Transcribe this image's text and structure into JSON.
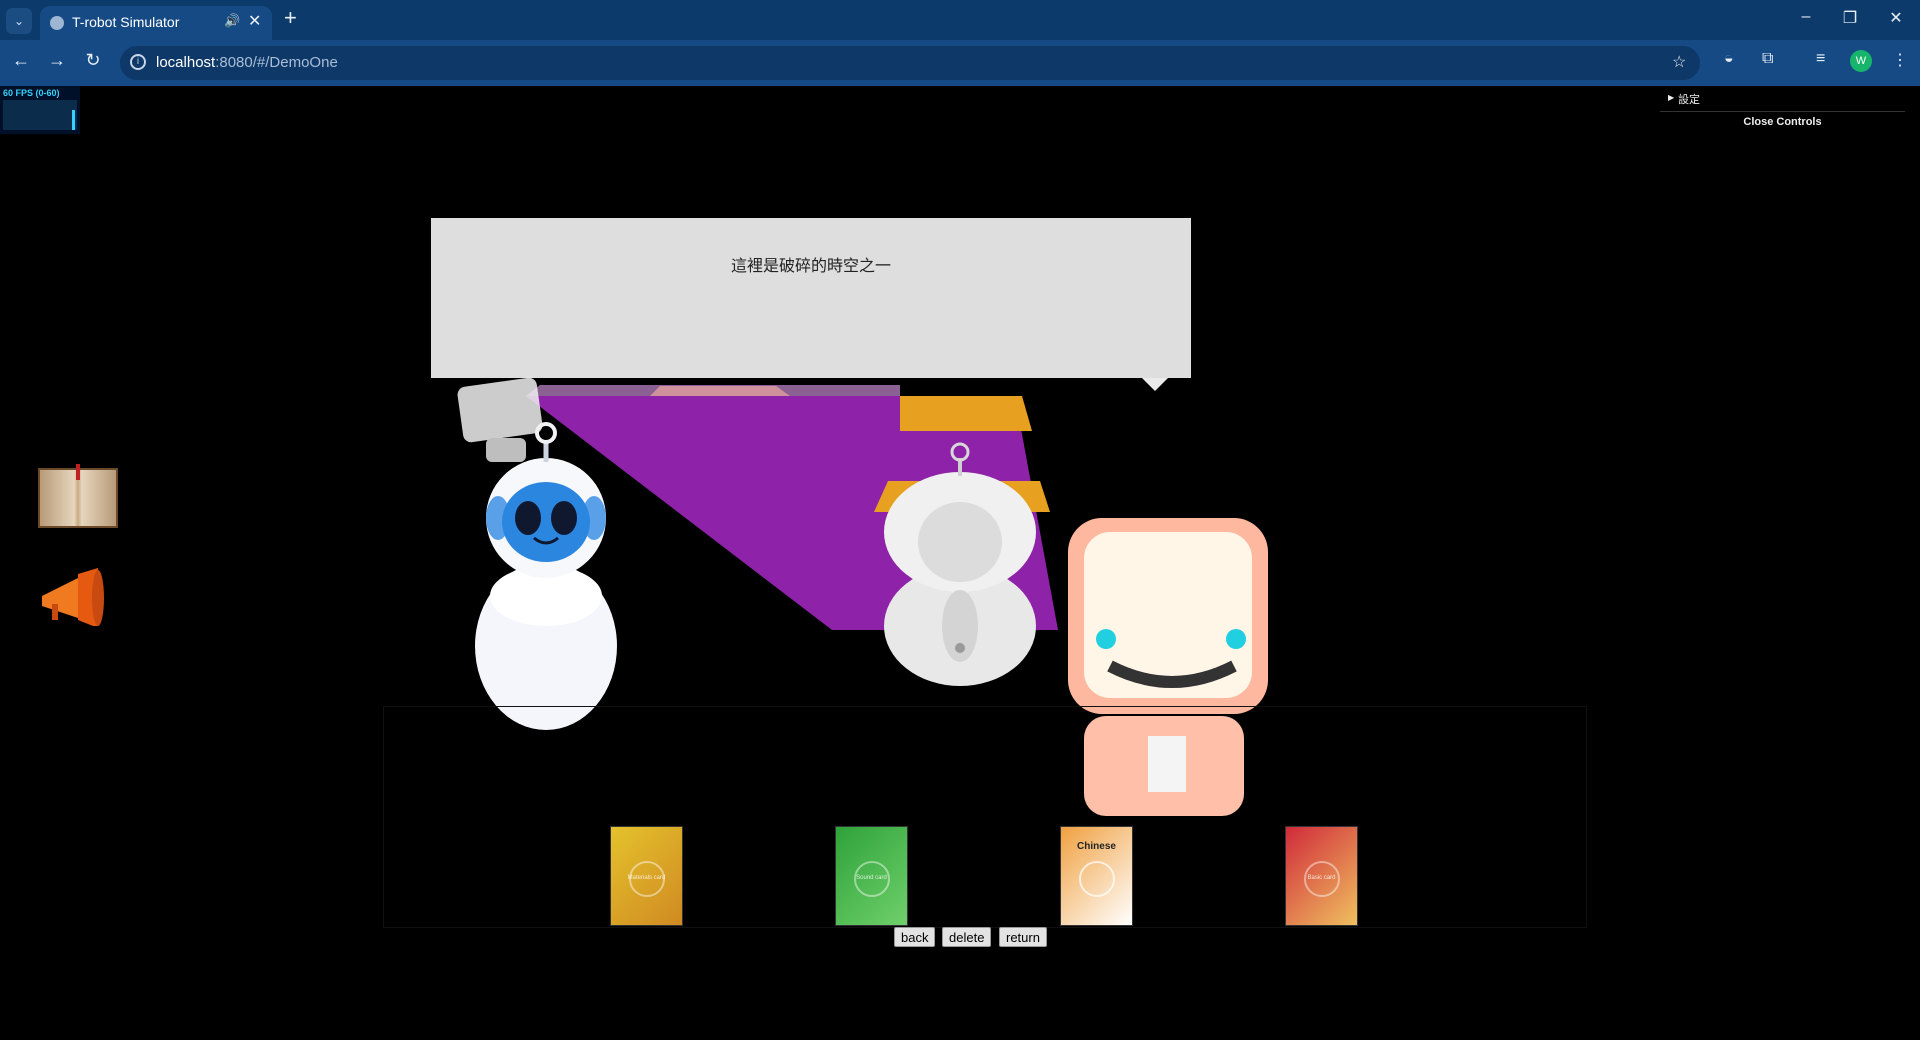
{
  "browser": {
    "tab_title": "T-robot Simulator",
    "url_host": "localhost",
    "url_path": ":8080/#/DemoOne",
    "avatar_letter": "W"
  },
  "stats": {
    "fps_label": "60 FPS (0-60)"
  },
  "controls": {
    "folder_title": "設定",
    "close_label": "Close Controls"
  },
  "speech": {
    "text": "這裡是破碎的時空之一"
  },
  "cards": [
    {
      "label": "",
      "sub": "Materials card",
      "color": "#e4c22c",
      "accent": "#d08a22"
    },
    {
      "label": "",
      "sub": "Sound card",
      "color": "#2fa23a",
      "accent": "#6fd06a"
    },
    {
      "label": "Chinese",
      "sub": "",
      "color": "#f0a040",
      "accent": "#ffffff"
    },
    {
      "label": "",
      "sub": "Basic card",
      "color": "#d02a3a",
      "accent": "#f0c060"
    }
  ],
  "buttons": {
    "back": "back",
    "delete": "delete",
    "return": "return"
  },
  "icons": {
    "book": "book-icon",
    "horn": "megaphone-icon"
  }
}
